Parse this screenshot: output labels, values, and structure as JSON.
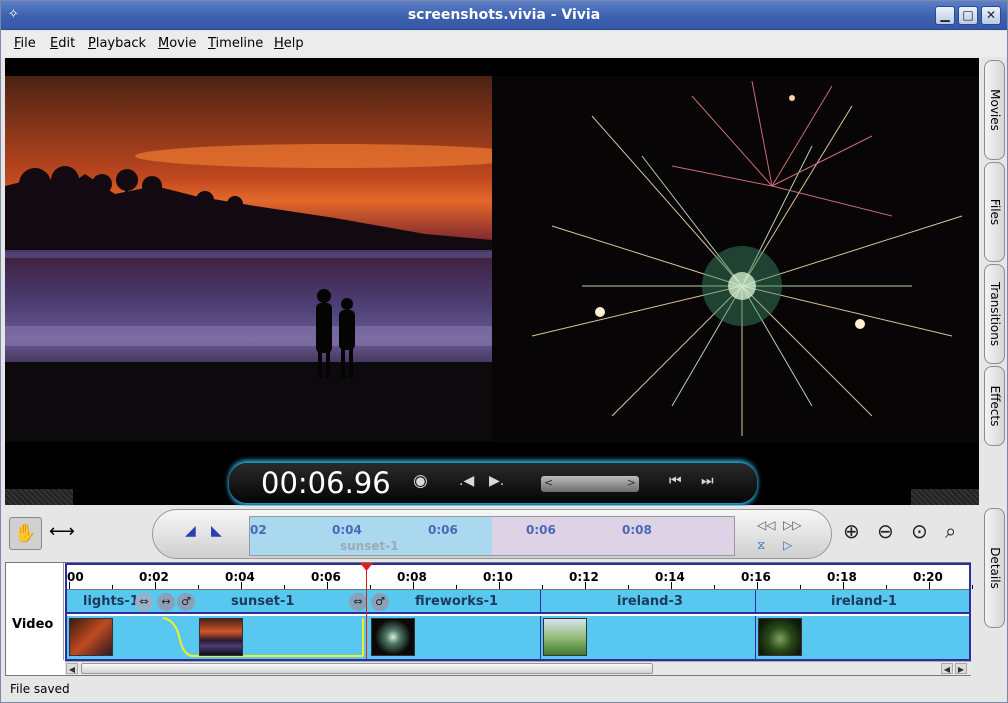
{
  "window": {
    "title": "screenshots.vivia - Vivia"
  },
  "menu": [
    "File",
    "Edit",
    "Playback",
    "Movie",
    "Timeline",
    "Help"
  ],
  "viewer": {
    "timecode": "00:06.96"
  },
  "side_tabs": [
    "Movies",
    "Files",
    "Transitions",
    "Effects",
    "Details"
  ],
  "navigator": {
    "ticks": [
      "02",
      "0:04",
      "0:06",
      "0:06",
      "0:08"
    ],
    "clip_label": "sunset-1"
  },
  "timeline": {
    "track_label": "Video",
    "ruler": [
      "00",
      "0:02",
      "0:04",
      "0:06",
      "0:08",
      "0:10",
      "0:12",
      "0:14",
      "0:16",
      "0:18",
      "0:20"
    ],
    "clips": [
      "lights-1",
      "sunset-1",
      "fireworks-1",
      "ireland-3",
      "ireland-1"
    ]
  },
  "status": {
    "text": "File saved"
  },
  "colors": {
    "titlebar": "#3e63b0",
    "clip_track": "#58c8f0",
    "timeline_border": "#2d2da0",
    "playhead": "#e02020"
  }
}
